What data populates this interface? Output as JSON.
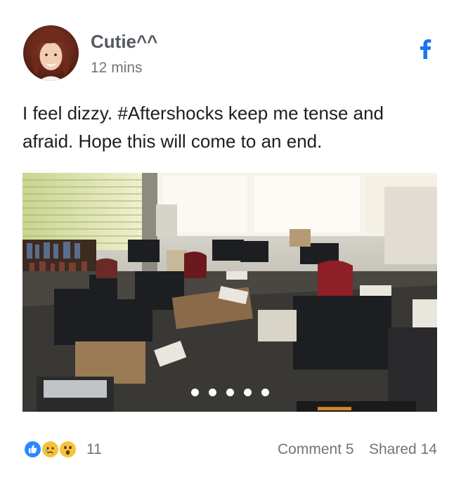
{
  "post": {
    "author": "Cutie^^",
    "time": "12 mins",
    "text": "I feel dizzy. #Aftershocks keep me tense and afraid. Hope this will come to an end.",
    "platform_icon": "facebook-icon",
    "photo": {
      "description_icon": "photo",
      "carousel_dots": 5
    }
  },
  "footer": {
    "reaction_icons": [
      "like-icon",
      "sad-icon",
      "wow-icon"
    ],
    "reaction_count": "11",
    "comments": "Comment 5",
    "shares": "Shared 14"
  },
  "colors": {
    "facebook_blue": "#1877f2",
    "secondary_text": "#70757a"
  }
}
